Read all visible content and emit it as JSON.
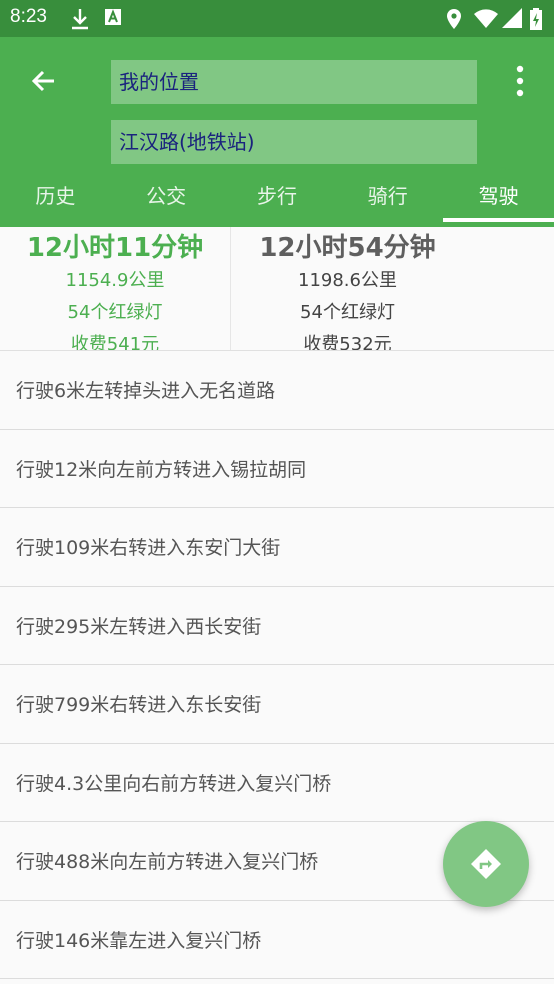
{
  "status_bar": {
    "time": "8:23"
  },
  "search": {
    "from": "我的位置",
    "to": "江汉路(地铁站)"
  },
  "tabs": [
    "历史",
    "公交",
    "步行",
    "骑行",
    "驾驶"
  ],
  "routes": [
    {
      "duration": "12小时11分钟",
      "distance": "1154.9公里",
      "lights": "54个红绿灯",
      "toll": "收费541元"
    },
    {
      "duration": "12小时54分钟",
      "distance": "1198.6公里",
      "lights": "54个红绿灯",
      "toll": "收费532元"
    }
  ],
  "steps": [
    "行驶6米左转掉头进入无名道路",
    "行驶12米向左前方转进入锡拉胡同",
    "行驶109米右转进入东安门大街",
    "行驶295米左转进入西长安街",
    "行驶799米右转进入东长安街",
    "行驶4.3公里向右前方转进入复兴门桥",
    "行驶488米向左前方转进入复兴门桥",
    "行驶146米靠左进入复兴门桥"
  ],
  "colors": {
    "primary": "#4caf50",
    "primary_dark": "#388e3c",
    "field": "#81c784",
    "selected_route": "#4caf50"
  },
  "icons": {
    "back": "arrow-left-icon",
    "menu": "more-vert-icon",
    "fab": "directions-icon"
  }
}
